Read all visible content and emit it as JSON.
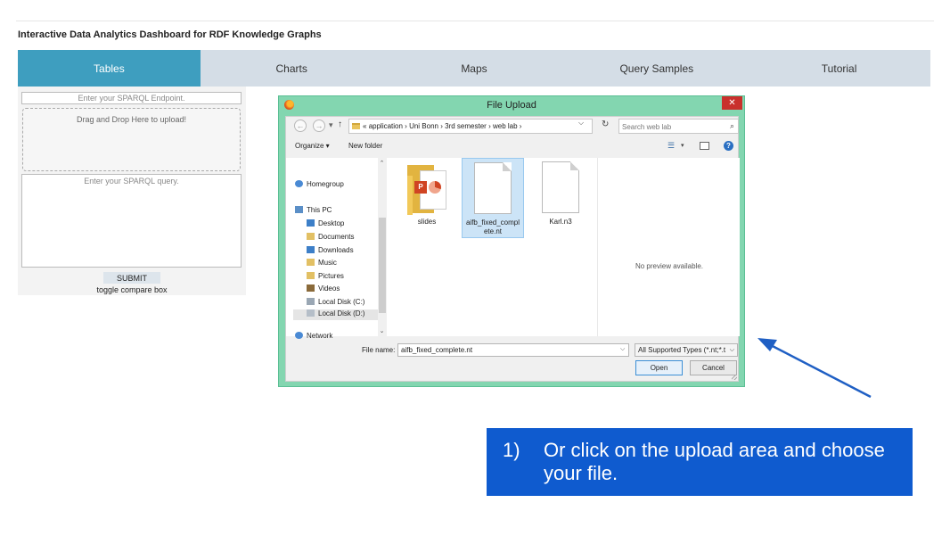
{
  "page": {
    "title": "Interactive Data Analytics Dashboard for RDF Knowledge Graphs"
  },
  "tabs": [
    {
      "label": "Tables",
      "active": true
    },
    {
      "label": "Charts",
      "active": false
    },
    {
      "label": "Maps",
      "active": false
    },
    {
      "label": "Query Samples",
      "active": false
    },
    {
      "label": "Tutorial",
      "active": false
    }
  ],
  "left_panel": {
    "endpoint_placeholder": "Enter your SPARQL Endpoint.",
    "dropzone_text": "Drag and Drop Here to upload!",
    "query_placeholder": "Enter your SPARQL query.",
    "submit_label": "SUBMIT",
    "toggle_label": "toggle compare box"
  },
  "dialog": {
    "title": "File Upload",
    "close_label": "✕",
    "nav": {
      "back": "←",
      "forward": "→",
      "recent": "▾",
      "up": "↑",
      "path_prefix": "«",
      "path": [
        "application",
        "Uni Bonn",
        "3rd semester",
        "web lab"
      ],
      "separator": "›",
      "dropdown": "⌵",
      "refresh": "↻",
      "search_placeholder": "Search web lab",
      "search_icon": "⌕"
    },
    "toolbar": {
      "organize": "Organize ▾",
      "new_folder": "New folder",
      "views_icon": "☰",
      "views_arrow": "▾",
      "help": "?"
    },
    "nav_pane": {
      "scroll_up": "⌃",
      "scroll_down": "⌄",
      "items": [
        {
          "label": "Homegroup",
          "icon": "homegroup-icon"
        },
        {
          "label": "This PC",
          "icon": "computer-icon"
        },
        {
          "label": "Desktop",
          "icon": "desktop-icon"
        },
        {
          "label": "Documents",
          "icon": "documents-icon"
        },
        {
          "label": "Downloads",
          "icon": "downloads-icon"
        },
        {
          "label": "Music",
          "icon": "music-icon"
        },
        {
          "label": "Pictures",
          "icon": "pictures-icon"
        },
        {
          "label": "Videos",
          "icon": "videos-icon"
        },
        {
          "label": "Local Disk (C:)",
          "icon": "drive-icon"
        },
        {
          "label": "Local Disk (D:)",
          "icon": "drive-icon",
          "selected": true
        },
        {
          "label": "Network",
          "icon": "network-icon"
        }
      ]
    },
    "files": [
      {
        "label": "slides",
        "type": "folder"
      },
      {
        "label": "aifb_fixed_compl\nete.nt",
        "type": "file",
        "selected": true
      },
      {
        "label": "Karl.n3",
        "type": "file"
      }
    ],
    "preview_text": "No preview available.",
    "filename_label": "File name:",
    "filename_value": "aifb_fixed_complete.nt",
    "filetype_value": "All Supported Types (*.nt;*.t",
    "open_label": "Open",
    "cancel_label": "Cancel"
  },
  "callout": {
    "number": "1)",
    "text": "Or click on the upload area and choose your file."
  },
  "colors": {
    "active_tab": "#3e9ebf",
    "tab_bar": "#d4dde6",
    "dialog_frame": "#83d6b0",
    "callout_bg": "#0f5bcf",
    "arrow": "#1f5fc4",
    "close_button": "#c9302c"
  }
}
